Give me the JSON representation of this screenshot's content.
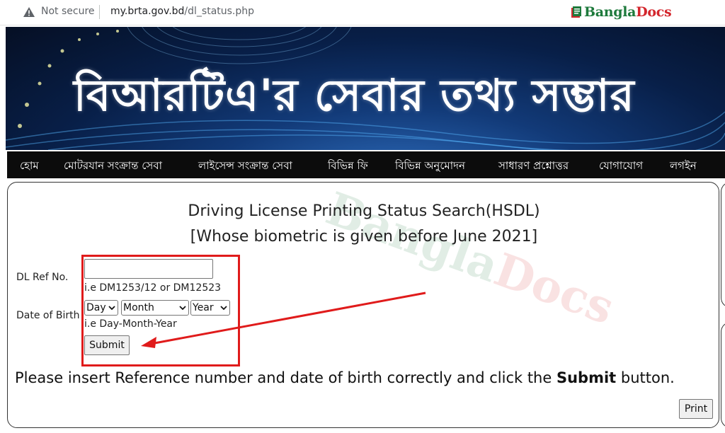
{
  "browser": {
    "security_label": "Not secure",
    "url_domain": "my.brta.gov.bd",
    "url_path": "/dl_status.php"
  },
  "brand": {
    "part1": "Bangla",
    "part2": "Docs",
    "colors": {
      "green": "#1e7a3c",
      "red": "#d3262c"
    }
  },
  "banner": {
    "title": "বিআরটিএ'র সেবার তথ্য সম্ভার"
  },
  "nav": {
    "items": [
      {
        "label": "হোম"
      },
      {
        "label": "মোটরযান সংক্রান্ত সেবা"
      },
      {
        "label": "লাইসেন্স সংক্রান্ত সেবা"
      },
      {
        "label": "বিভিন্ন ফি"
      },
      {
        "label": "বিভিন্ন অনুমোদন"
      },
      {
        "label": "সাধারণ প্রশ্নোত্তর"
      },
      {
        "label": "যোগাযোগ"
      },
      {
        "label": "লগইন"
      }
    ]
  },
  "form": {
    "title": "Driving License Printing Status Search(HSDL)",
    "subtitle": "[Whose biometric is given before June 2021]",
    "dl_ref": {
      "label": "DL Ref No.",
      "value": "",
      "hint": "i.e DM1253/12 or DM12523"
    },
    "dob": {
      "label": "Date of Birth",
      "day": "Day",
      "month": "Month",
      "year": "Year",
      "hint": "i.e Day-Month-Year"
    },
    "submit_label": "Submit",
    "note_prefix": "Please insert Reference number and date of birth correctly and click the ",
    "note_bold": "Submit",
    "note_suffix": " button.",
    "print_label": "Print"
  },
  "watermark": {
    "part1": "Bangla",
    "part2": "Docs"
  },
  "colors": {
    "highlight_red": "#e01b1b",
    "nav_bg": "#0c0c0c"
  }
}
